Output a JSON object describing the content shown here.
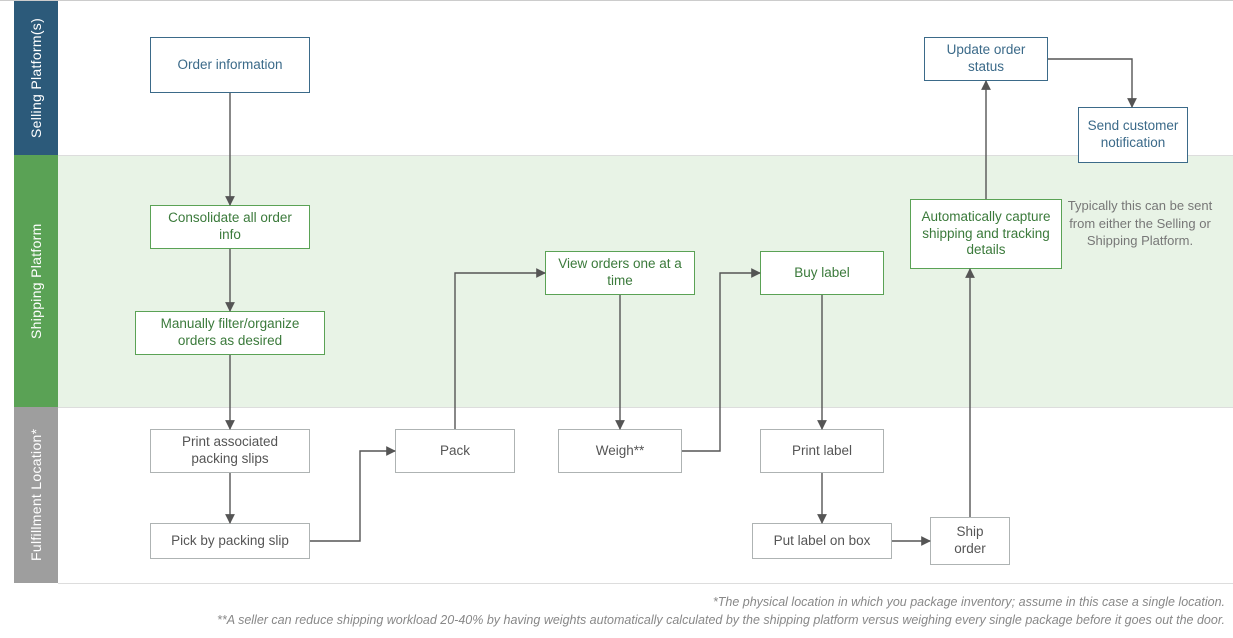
{
  "lanes": {
    "selling": "Selling Platform(s)",
    "shipping": "Shipping Platform",
    "fulfil": "Fulfillment Location*"
  },
  "boxes": {
    "order_info": "Order information",
    "consolidate": "Consolidate all order info",
    "manual_filter": "Manually filter/organize orders as desired",
    "print_packing": "Print associated packing slips",
    "pick": "Pick by packing slip",
    "pack": "Pack",
    "view_one": "View orders one at a time",
    "weigh": "Weigh**",
    "buy_label": "Buy label",
    "print_label": "Print label",
    "put_label": "Put label on box",
    "ship": "Ship order",
    "auto_capture": "Automatically capture shipping and tracking details",
    "update_status": "Update order status",
    "send_notif": "Send customer notification"
  },
  "notes": {
    "either_platform": "Typically this can be sent from either the Selling or Shipping Platform."
  },
  "footnotes": {
    "f1": "*The physical location in which you package inventory; assume in this case a single location.",
    "f2": "**A seller can reduce shipping workload 20-40% by having weights automatically calculated by the shipping platform versus weighing every single package before it goes out the door."
  }
}
